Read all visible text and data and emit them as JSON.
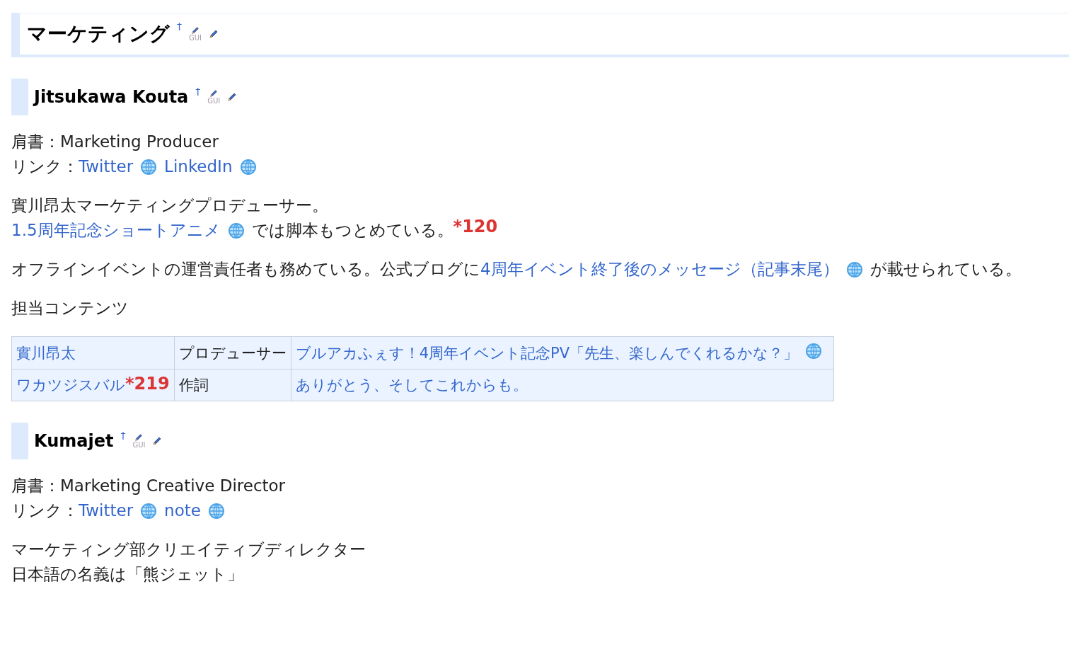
{
  "section": {
    "title": "マーケティング",
    "dagger": "†",
    "gui_label": "GUI"
  },
  "people": [
    {
      "name": "Jitsukawa Kouta",
      "dagger": "†",
      "gui_label": "GUI",
      "blocks": [
        {
          "kind": "paragraph",
          "lines": [
            [
              {
                "kind": "text",
                "text": "肩書：Marketing Producer"
              }
            ],
            [
              {
                "kind": "text",
                "text": "リンク："
              },
              {
                "kind": "link",
                "text": "Twitter",
                "external": true
              },
              {
                "kind": "link",
                "text": "LinkedIn",
                "external": true
              }
            ]
          ]
        },
        {
          "kind": "paragraph",
          "lines": [
            [
              {
                "kind": "text",
                "text": "實川昂太マーケティングプロデューサー。"
              }
            ],
            [
              {
                "kind": "link",
                "text": "1.5周年記念ショートアニメ",
                "external": true
              },
              {
                "kind": "text",
                "text": "では脚本もつとめている。"
              },
              {
                "kind": "ref",
                "text": "*120"
              }
            ]
          ]
        },
        {
          "kind": "paragraph",
          "lines": [
            [
              {
                "kind": "text",
                "text": "オフラインイベントの運営責任者も務めている。公式ブログに"
              },
              {
                "kind": "link",
                "text": "4周年イベント終了後のメッセージ（記事末尾）",
                "external": true
              },
              {
                "kind": "text",
                "text": "が載せられている。"
              }
            ]
          ]
        },
        {
          "kind": "paragraph",
          "lines": [
            [
              {
                "kind": "text",
                "text": "担当コンテンツ"
              }
            ]
          ]
        },
        {
          "kind": "table",
          "rows": [
            [
              [
                {
                  "kind": "link",
                  "text": "實川昂太",
                  "external": false
                }
              ],
              [
                {
                  "kind": "text",
                  "text": "プロデューサー"
                }
              ],
              [
                {
                  "kind": "link",
                  "text": "ブルアカふぇす！4周年イベント記念PV「先生、楽しんでくれるかな？」",
                  "external": true
                }
              ]
            ],
            [
              [
                {
                  "kind": "link",
                  "text": "ワカツジスバル",
                  "external": false
                },
                {
                  "kind": "ref",
                  "text": "*219"
                }
              ],
              [
                {
                  "kind": "text",
                  "text": "作詞"
                }
              ],
              [
                {
                  "kind": "link",
                  "text": "ありがとう、そしてこれからも。",
                  "external": false
                }
              ]
            ]
          ]
        }
      ]
    },
    {
      "name": "Kumajet",
      "dagger": "†",
      "gui_label": "GUI",
      "blocks": [
        {
          "kind": "paragraph",
          "lines": [
            [
              {
                "kind": "text",
                "text": "肩書：Marketing Creative Director"
              }
            ],
            [
              {
                "kind": "text",
                "text": "リンク："
              },
              {
                "kind": "link",
                "text": "Twitter",
                "external": true
              },
              {
                "kind": "link",
                "text": "note",
                "external": true
              }
            ]
          ]
        },
        {
          "kind": "paragraph",
          "lines": [
            [
              {
                "kind": "text",
                "text": "マーケティング部クリエイティブディレクター"
              }
            ],
            [
              {
                "kind": "text",
                "text": "日本語の名義は「熊ジェット」"
              }
            ]
          ]
        }
      ]
    }
  ]
}
